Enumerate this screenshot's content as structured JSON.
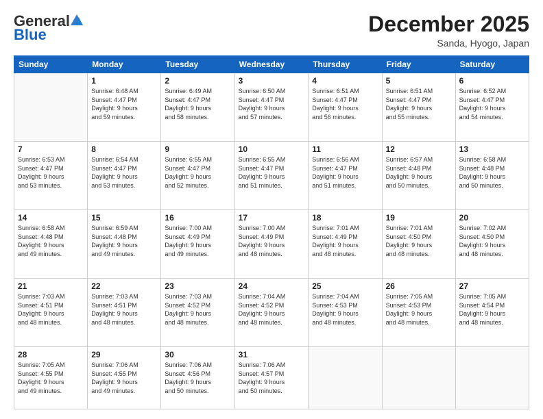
{
  "logo": {
    "general": "General",
    "blue": "Blue"
  },
  "header": {
    "month": "December 2025",
    "location": "Sanda, Hyogo, Japan"
  },
  "weekdays": [
    "Sunday",
    "Monday",
    "Tuesday",
    "Wednesday",
    "Thursday",
    "Friday",
    "Saturday"
  ],
  "weeks": [
    [
      {
        "day": "",
        "info": ""
      },
      {
        "day": "1",
        "info": "Sunrise: 6:48 AM\nSunset: 4:47 PM\nDaylight: 9 hours\nand 59 minutes."
      },
      {
        "day": "2",
        "info": "Sunrise: 6:49 AM\nSunset: 4:47 PM\nDaylight: 9 hours\nand 58 minutes."
      },
      {
        "day": "3",
        "info": "Sunrise: 6:50 AM\nSunset: 4:47 PM\nDaylight: 9 hours\nand 57 minutes."
      },
      {
        "day": "4",
        "info": "Sunrise: 6:51 AM\nSunset: 4:47 PM\nDaylight: 9 hours\nand 56 minutes."
      },
      {
        "day": "5",
        "info": "Sunrise: 6:51 AM\nSunset: 4:47 PM\nDaylight: 9 hours\nand 55 minutes."
      },
      {
        "day": "6",
        "info": "Sunrise: 6:52 AM\nSunset: 4:47 PM\nDaylight: 9 hours\nand 54 minutes."
      }
    ],
    [
      {
        "day": "7",
        "info": "Sunrise: 6:53 AM\nSunset: 4:47 PM\nDaylight: 9 hours\nand 53 minutes."
      },
      {
        "day": "8",
        "info": "Sunrise: 6:54 AM\nSunset: 4:47 PM\nDaylight: 9 hours\nand 53 minutes."
      },
      {
        "day": "9",
        "info": "Sunrise: 6:55 AM\nSunset: 4:47 PM\nDaylight: 9 hours\nand 52 minutes."
      },
      {
        "day": "10",
        "info": "Sunrise: 6:55 AM\nSunset: 4:47 PM\nDaylight: 9 hours\nand 51 minutes."
      },
      {
        "day": "11",
        "info": "Sunrise: 6:56 AM\nSunset: 4:47 PM\nDaylight: 9 hours\nand 51 minutes."
      },
      {
        "day": "12",
        "info": "Sunrise: 6:57 AM\nSunset: 4:48 PM\nDaylight: 9 hours\nand 50 minutes."
      },
      {
        "day": "13",
        "info": "Sunrise: 6:58 AM\nSunset: 4:48 PM\nDaylight: 9 hours\nand 50 minutes."
      }
    ],
    [
      {
        "day": "14",
        "info": "Sunrise: 6:58 AM\nSunset: 4:48 PM\nDaylight: 9 hours\nand 49 minutes."
      },
      {
        "day": "15",
        "info": "Sunrise: 6:59 AM\nSunset: 4:48 PM\nDaylight: 9 hours\nand 49 minutes."
      },
      {
        "day": "16",
        "info": "Sunrise: 7:00 AM\nSunset: 4:49 PM\nDaylight: 9 hours\nand 49 minutes."
      },
      {
        "day": "17",
        "info": "Sunrise: 7:00 AM\nSunset: 4:49 PM\nDaylight: 9 hours\nand 48 minutes."
      },
      {
        "day": "18",
        "info": "Sunrise: 7:01 AM\nSunset: 4:49 PM\nDaylight: 9 hours\nand 48 minutes."
      },
      {
        "day": "19",
        "info": "Sunrise: 7:01 AM\nSunset: 4:50 PM\nDaylight: 9 hours\nand 48 minutes."
      },
      {
        "day": "20",
        "info": "Sunrise: 7:02 AM\nSunset: 4:50 PM\nDaylight: 9 hours\nand 48 minutes."
      }
    ],
    [
      {
        "day": "21",
        "info": "Sunrise: 7:03 AM\nSunset: 4:51 PM\nDaylight: 9 hours\nand 48 minutes."
      },
      {
        "day": "22",
        "info": "Sunrise: 7:03 AM\nSunset: 4:51 PM\nDaylight: 9 hours\nand 48 minutes."
      },
      {
        "day": "23",
        "info": "Sunrise: 7:03 AM\nSunset: 4:52 PM\nDaylight: 9 hours\nand 48 minutes."
      },
      {
        "day": "24",
        "info": "Sunrise: 7:04 AM\nSunset: 4:52 PM\nDaylight: 9 hours\nand 48 minutes."
      },
      {
        "day": "25",
        "info": "Sunrise: 7:04 AM\nSunset: 4:53 PM\nDaylight: 9 hours\nand 48 minutes."
      },
      {
        "day": "26",
        "info": "Sunrise: 7:05 AM\nSunset: 4:53 PM\nDaylight: 9 hours\nand 48 minutes."
      },
      {
        "day": "27",
        "info": "Sunrise: 7:05 AM\nSunset: 4:54 PM\nDaylight: 9 hours\nand 48 minutes."
      }
    ],
    [
      {
        "day": "28",
        "info": "Sunrise: 7:05 AM\nSunset: 4:55 PM\nDaylight: 9 hours\nand 49 minutes."
      },
      {
        "day": "29",
        "info": "Sunrise: 7:06 AM\nSunset: 4:55 PM\nDaylight: 9 hours\nand 49 minutes."
      },
      {
        "day": "30",
        "info": "Sunrise: 7:06 AM\nSunset: 4:56 PM\nDaylight: 9 hours\nand 50 minutes."
      },
      {
        "day": "31",
        "info": "Sunrise: 7:06 AM\nSunset: 4:57 PM\nDaylight: 9 hours\nand 50 minutes."
      },
      {
        "day": "",
        "info": ""
      },
      {
        "day": "",
        "info": ""
      },
      {
        "day": "",
        "info": ""
      }
    ]
  ]
}
